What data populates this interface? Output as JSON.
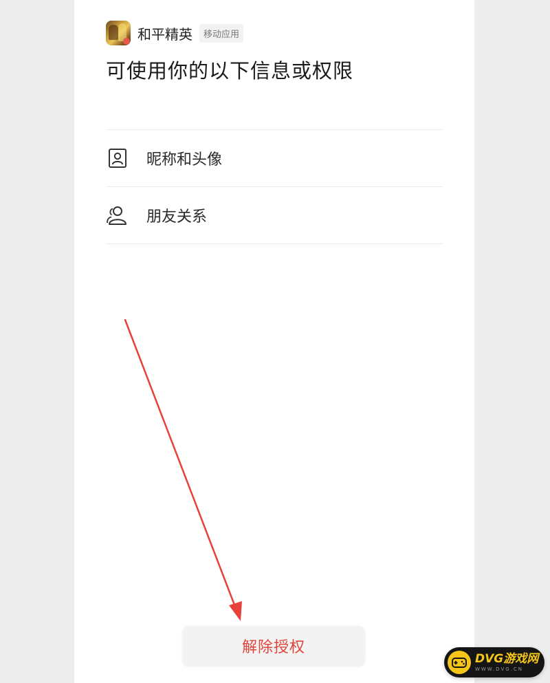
{
  "app": {
    "name": "和平精英",
    "tag": "移动应用"
  },
  "page": {
    "title": "可使用你的以下信息或权限"
  },
  "permissions": [
    {
      "label": "昵称和头像",
      "icon": "profile-card-icon"
    },
    {
      "label": "朋友关系",
      "icon": "friends-icon"
    }
  ],
  "actions": {
    "revoke_label": "解除授权"
  },
  "watermark": {
    "main": "DVG游戏网",
    "sub": "WWW.DVG.CN"
  },
  "colors": {
    "revoke_text": "#e0443a",
    "annotation_arrow": "#e8403a",
    "watermark_accent": "#f5c518"
  }
}
